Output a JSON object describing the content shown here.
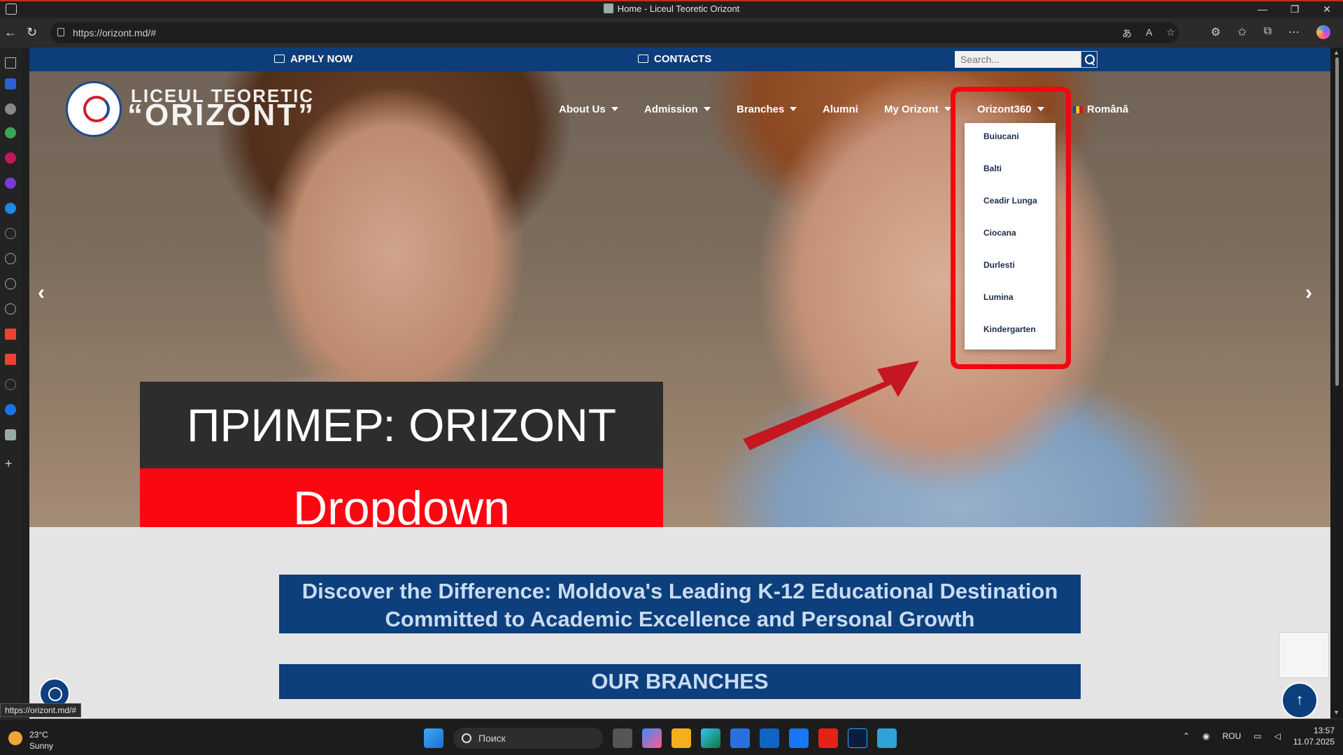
{
  "window": {
    "title": "Home - Liceul Teoretic Orizont"
  },
  "browser": {
    "url": "https://orizont.md/#"
  },
  "site": {
    "topbar": {
      "apply": "APPLY NOW",
      "contacts": "CONTACTS",
      "search_placeholder": "Search..."
    },
    "brand": {
      "line1": "LICEUL TEORETIC",
      "line2": "“ORIZONT”"
    },
    "menu": {
      "about": "About Us",
      "admission": "Admission",
      "branches": "Branches",
      "alumni": "Alumni",
      "my_orizont": "My Orizont",
      "orizont360": "Orizont360",
      "language": "Română"
    },
    "dropdown": [
      "Buiucani",
      "Balti",
      "Ceadir Lunga",
      "Ciocana",
      "Durlesti",
      "Lumina",
      "Kindergarten"
    ],
    "overlay": {
      "line1": "ПРИМЕР: ORIZONT",
      "line2": "Dropdown"
    },
    "headline": {
      "line1": "Discover the Difference: Moldova's Leading K-12 Educational Destination",
      "line2": "Committed to Academic Excellence and Personal Growth"
    },
    "branches_title": "OUR BRANCHES",
    "status_url": "https://orizont.md/#"
  },
  "taskbar": {
    "weather_temp": "23°C",
    "weather_desc": "Sunny",
    "search_label": "Поиск",
    "lang": "ROU",
    "time": "13:57",
    "date": "11.07.2025"
  },
  "colors": {
    "brand_blue": "#0d3d7a",
    "highlight_red": "#f2060f"
  }
}
